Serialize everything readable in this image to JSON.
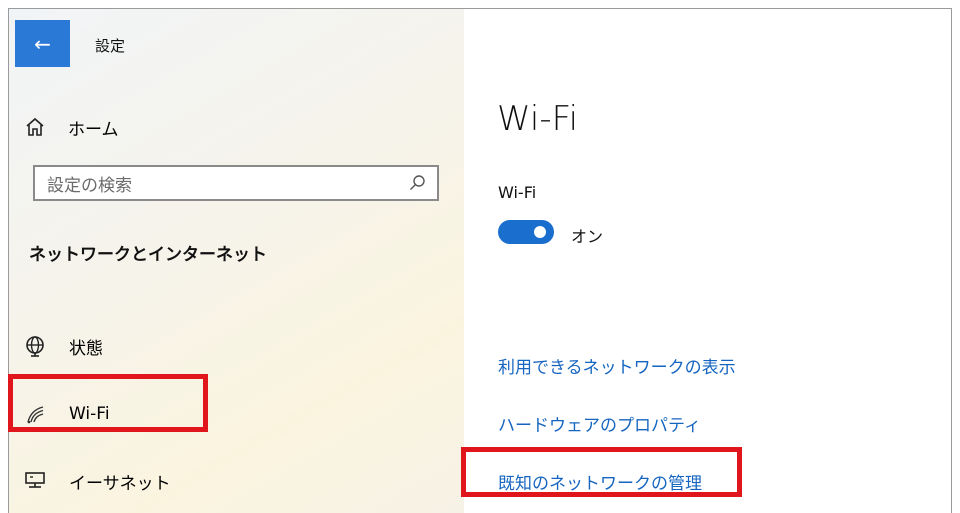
{
  "window": {
    "title": "設定"
  },
  "sidebar": {
    "back_icon": "arrow-left-icon",
    "home": {
      "label": "ホーム",
      "icon": "home-icon"
    },
    "search": {
      "placeholder": "設定の検索",
      "icon": "search-icon"
    },
    "section_title": "ネットワークとインターネット",
    "items": [
      {
        "label": "状態",
        "icon": "globe-icon"
      },
      {
        "label": "Wi-Fi",
        "icon": "wifi-icon",
        "selected": true
      },
      {
        "label": "イーサネット",
        "icon": "ethernet-icon"
      }
    ]
  },
  "main": {
    "title": "Wi-Fi",
    "wifi_label": "Wi-Fi",
    "toggle": {
      "state": "オン",
      "on": true
    },
    "links": [
      {
        "label": "利用できるネットワークの表示"
      },
      {
        "label": "ハードウェアのプロパティ"
      },
      {
        "label": "既知のネットワークの管理",
        "highlighted": true
      }
    ]
  },
  "colors": {
    "accent": "#2b79d6",
    "toggle_on": "#1a6fce",
    "link": "#1565c0",
    "highlight_border": "#e0161c"
  }
}
